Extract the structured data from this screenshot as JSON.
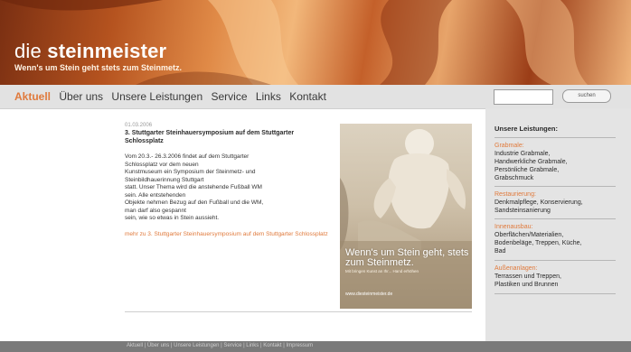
{
  "header": {
    "logo_light": "die ",
    "logo_bold": "steinmeister",
    "tagline": "Wenn's um Stein geht stets zum Steinmetz."
  },
  "nav": {
    "items": [
      "Aktuell",
      "Über uns",
      "Unsere Leistungen",
      "Service",
      "Links",
      "Kontakt"
    ],
    "active": "Aktuell"
  },
  "search": {
    "placeholder": "",
    "button_label": "suchen"
  },
  "article": {
    "date": "01.03.2006",
    "title": "3. Stuttgarter Steinhauersymposium auf dem Stuttgarter Schlossplatz",
    "lines": [
      "Vom 20.3.- 26.3.2006 findet auf dem Stuttgarter",
      "Schlossplatz vor dem neuen",
      "Kunstmuseum ein Symposium der Steinmetz- und",
      "Steinbildhauerinnung Stuttgart",
      "statt. Unser Thema wird die anstehende Fußball WM",
      "sein. Alle entstehenden",
      "Objekte nehmen Bezug auf den Fußball und die WM,",
      "man darf also gespannt",
      "sein, wie so etwas in Stein aussieht."
    ],
    "more_link": "mehr zu 3. Stuttgarter Steinhauersymposium auf dem Stuttgarter Schlossplatz"
  },
  "feature": {
    "headline": "Wenn's um Stein geht, stets zum Steinmetz.",
    "subline": "Mit bringen Kunst an Ihr... Hand erhöhen",
    "url": "www.diesteinmeister.de"
  },
  "sidebar": {
    "heading": "Unsere Leistungen:",
    "groups": [
      {
        "category": "Grabmale:",
        "items": [
          "Industrie Grabmale,",
          "Handwerkliche Grabmale,",
          "Persönliche Grabmale,",
          "Grabschmuck"
        ]
      },
      {
        "category": "Restaurierung:",
        "items": [
          "Denkmalpflege, Konservierung,",
          "Sandsteinsanierung"
        ]
      },
      {
        "category": "Innenausbau:",
        "items": [
          "Oberflächen/Materialien,",
          "Bodenbeläge, Treppen, Küche,",
          "Bad"
        ]
      },
      {
        "category": "Außenanlagen:",
        "items": [
          "Terrassen und Treppen,",
          "Plastiken und Brunnen"
        ]
      }
    ]
  },
  "footer": {
    "links_text": "Aktuell  |  Über uns  |  Unsere Leistungen  |  Service  |  Links  |  Kontakt  |  Impressum"
  },
  "colors": {
    "accent": "#e07a3c",
    "nav_bg": "#e2e2e2",
    "sidebar_bg": "#e4e4e4",
    "footer_bg": "#7a7a7a"
  }
}
